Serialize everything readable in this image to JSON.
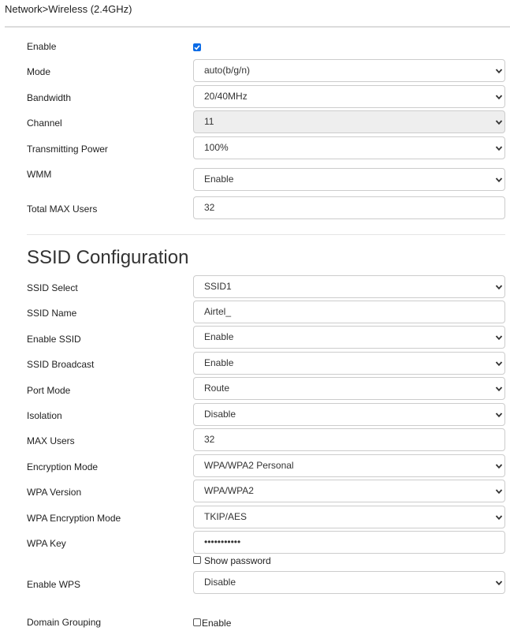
{
  "breadcrumb": "Network>Wireless (2.4GHz)",
  "wireless": {
    "enable_label": "Enable",
    "enable_checked": true,
    "mode": {
      "label": "Mode",
      "value": "auto(b/g/n)"
    },
    "bandwidth": {
      "label": "Bandwidth",
      "value": "20/40MHz"
    },
    "channel": {
      "label": "Channel",
      "value": "11"
    },
    "transmitting_power": {
      "label": "Transmitting Power",
      "value": "100%"
    },
    "wmm": {
      "label": "WMM",
      "value": "Enable"
    },
    "total_max_users": {
      "label": "Total MAX Users",
      "value": "32"
    }
  },
  "ssid_section_title": "SSID Configuration",
  "ssid": {
    "ssid_select": {
      "label": "SSID Select",
      "value": "SSID1"
    },
    "ssid_name": {
      "label": "SSID Name",
      "value": "Airtel_"
    },
    "enable_ssid": {
      "label": "Enable SSID",
      "value": "Enable"
    },
    "ssid_broadcast": {
      "label": "SSID Broadcast",
      "value": "Enable"
    },
    "port_mode": {
      "label": "Port Mode",
      "value": "Route"
    },
    "isolation": {
      "label": "Isolation",
      "value": "Disable"
    },
    "max_users": {
      "label": "MAX Users",
      "value": "32"
    },
    "encryption_mode": {
      "label": "Encryption Mode",
      "value": "WPA/WPA2 Personal"
    },
    "wpa_version": {
      "label": "WPA Version",
      "value": "WPA/WPA2"
    },
    "wpa_encryption_mode": {
      "label": "WPA Encryption Mode",
      "value": "TKIP/AES"
    },
    "wpa_key": {
      "label": "WPA Key",
      "value": "•••••••••••",
      "show_password_label": "Show password"
    },
    "enable_wps": {
      "label": "Enable WPS",
      "value": "Disable"
    },
    "domain_grouping": {
      "label": "Domain Grouping",
      "checkbox_label": "Enable"
    }
  },
  "colors": {
    "checkbox_accent": "#0b6be6",
    "disabled_bg": "#eeeeee",
    "border": "#cccccc"
  }
}
